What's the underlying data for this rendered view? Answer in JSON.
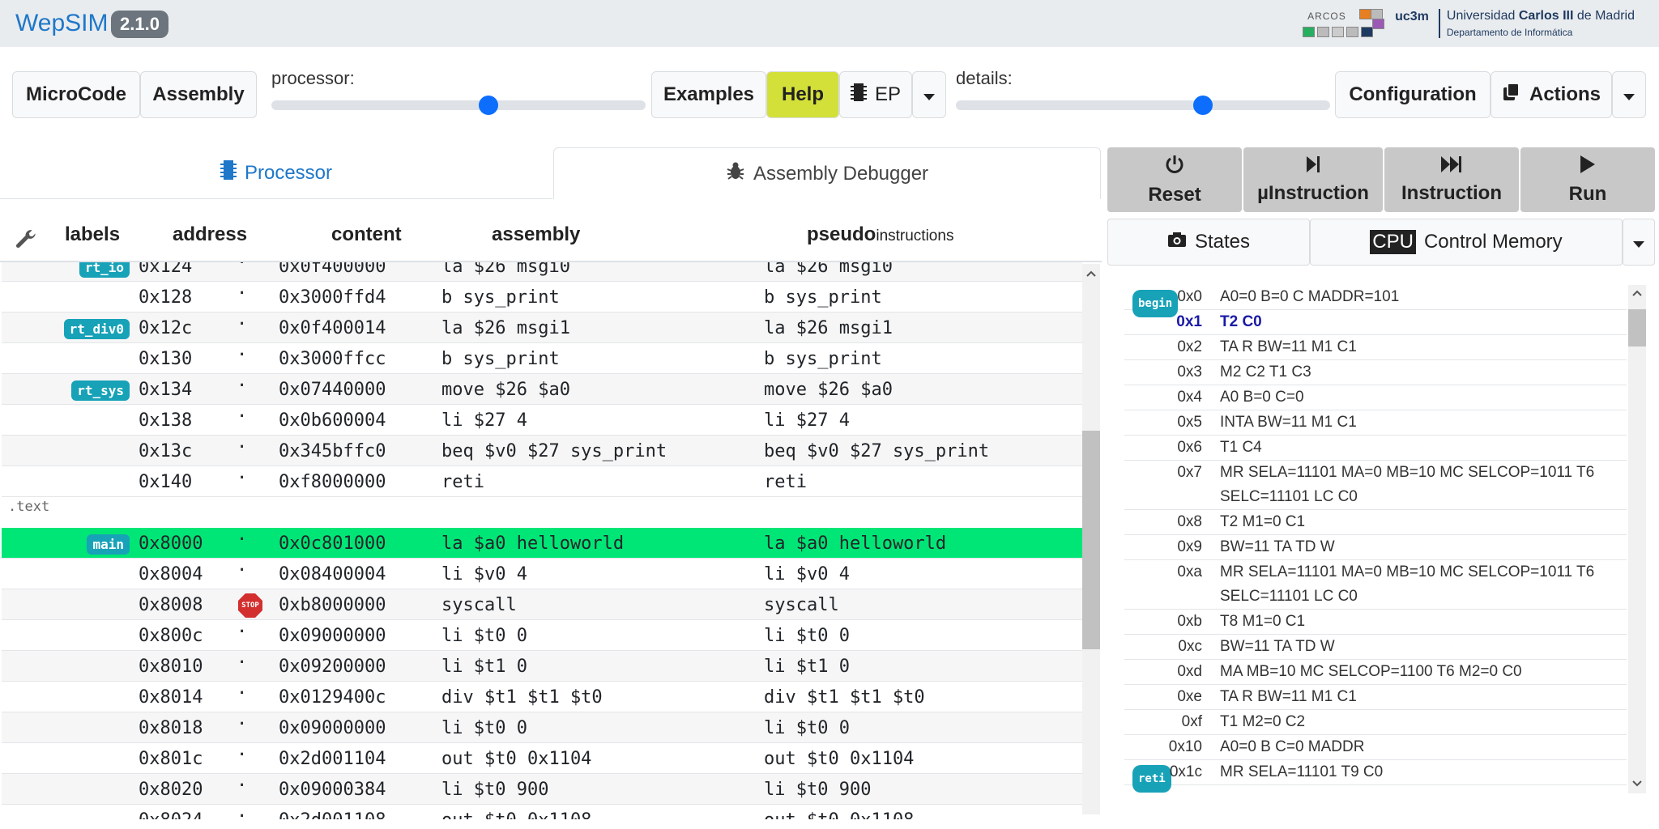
{
  "app": {
    "name": "WepSIM",
    "version": "2.1.0"
  },
  "logos": {
    "arcos": "ARCOS",
    "uc3m": "uc3m",
    "university_prefix": "Universidad ",
    "university_bold": "Carlos III",
    "university_suffix": " de Madrid",
    "department": "Departamento de Informática"
  },
  "toolbar": {
    "microcode": "MicroCode",
    "assembly": "Assembly",
    "processor_label": "processor:",
    "processor_level": 0.58,
    "examples": "Examples",
    "help": "Help",
    "ep": "EP",
    "details_label": "details:",
    "details_level": 0.66,
    "configuration": "Configuration",
    "actions": "Actions"
  },
  "tabs": {
    "processor": "Processor",
    "debugger": "Assembly Debugger"
  },
  "table": {
    "headers": {
      "labels": "labels",
      "address": "address",
      "content": "content",
      "assembly": "assembly",
      "pseudo": "pseudo",
      "pseudo_suffix": "instructions"
    },
    "rows": [
      {
        "label": "rt_io",
        "addr": "0x124",
        "content": "0x0f400000",
        "asm": "la $26 msgi0",
        "pseudo": "la $26 msgi0",
        "partial": true
      },
      {
        "label": "",
        "addr": "0x128",
        "content": "0x3000ffd4",
        "asm": "b sys_print",
        "pseudo": "b sys_print"
      },
      {
        "label": "rt_div0",
        "addr": "0x12c",
        "content": "0x0f400014",
        "asm": "la $26 msgi1",
        "pseudo": "la $26 msgi1"
      },
      {
        "label": "",
        "addr": "0x130",
        "content": "0x3000ffcc",
        "asm": "b sys_print",
        "pseudo": "b sys_print"
      },
      {
        "label": "rt_sys",
        "addr": "0x134",
        "content": "0x07440000",
        "asm": "move $26 $a0",
        "pseudo": "move $26 $a0"
      },
      {
        "label": "",
        "addr": "0x138",
        "content": "0x0b600004",
        "asm": "li $27 4",
        "pseudo": "li $27 4"
      },
      {
        "label": "",
        "addr": "0x13c",
        "content": "0x345bffc0",
        "asm": "beq $v0 $27 sys_print",
        "pseudo": "beq $v0 $27 sys_print"
      },
      {
        "label": "",
        "addr": "0x140",
        "content": "0xf8000000",
        "asm": "reti",
        "pseudo": "reti"
      },
      {
        "section": ".text"
      },
      {
        "label": "main",
        "addr": "0x8000",
        "content": "0x0c801000",
        "asm": "la $a0 helloworld",
        "pseudo": "la $a0 helloworld",
        "current": true
      },
      {
        "label": "",
        "addr": "0x8004",
        "content": "0x08400004",
        "asm": "li $v0 4",
        "pseudo": "li $v0 4"
      },
      {
        "label": "",
        "addr": "0x8008",
        "content": "0xb8000000",
        "asm": "syscall",
        "pseudo": "syscall",
        "breakpoint": "STOP"
      },
      {
        "label": "",
        "addr": "0x800c",
        "content": "0x09000000",
        "asm": "li $t0 0",
        "pseudo": "li $t0 0"
      },
      {
        "label": "",
        "addr": "0x8010",
        "content": "0x09200000",
        "asm": "li $t1 0",
        "pseudo": "li $t1 0"
      },
      {
        "label": "",
        "addr": "0x8014",
        "content": "0x0129400c",
        "asm": "div $t1 $t1 $t0",
        "pseudo": "div $t1 $t1 $t0"
      },
      {
        "label": "",
        "addr": "0x8018",
        "content": "0x09000000",
        "asm": "li $t0 0",
        "pseudo": "li $t0 0"
      },
      {
        "label": "",
        "addr": "0x801c",
        "content": "0x2d001104",
        "asm": "out $t0 0x1104",
        "pseudo": "out $t0 0x1104"
      },
      {
        "label": "",
        "addr": "0x8020",
        "content": "0x09000384",
        "asm": "li $t0 900",
        "pseudo": "li $t0 900"
      },
      {
        "label": "",
        "addr": "0x8024",
        "content": "0x2d001108",
        "asm": "out $t0 0x1108",
        "pseudo": "out $t0 0x1108"
      }
    ]
  },
  "controls": {
    "reset": "Reset",
    "uinstruction": "µInstruction",
    "instruction": "Instruction",
    "run": "Run",
    "states": "States",
    "cpu_badge": "CPU",
    "control_memory": "Control Memory"
  },
  "control_memory": [
    {
      "addr": "0x0",
      "label": "begin",
      "value": "A0=0 B=0 C MADDR=101"
    },
    {
      "addr": "0x1",
      "value": "T2 C0",
      "current": true
    },
    {
      "addr": "0x2",
      "value": "TA R BW=11 M1 C1"
    },
    {
      "addr": "0x3",
      "value": "M2 C2 T1 C3"
    },
    {
      "addr": "0x4",
      "value": "A0 B=0 C=0"
    },
    {
      "addr": "0x5",
      "value": "INTA BW=11 M1 C1"
    },
    {
      "addr": "0x6",
      "value": "T1 C4"
    },
    {
      "addr": "0x7",
      "value": "MR SELA=11101 MA=0 MB=10 MC SELCOP=1011 T6 SELC=11101 LC C0"
    },
    {
      "addr": "0x8",
      "value": "T2 M1=0 C1"
    },
    {
      "addr": "0x9",
      "value": "BW=11 TA TD W"
    },
    {
      "addr": "0xa",
      "value": "MR SELA=11101 MA=0 MB=10 MC SELCOP=1011 T6 SELC=11101 LC C0"
    },
    {
      "addr": "0xb",
      "value": "T8 M1=0 C1"
    },
    {
      "addr": "0xc",
      "value": "BW=11 TA TD W"
    },
    {
      "addr": "0xd",
      "value": "MA MB=10 MC SELCOP=1100 T6 M2=0 C0"
    },
    {
      "addr": "0xe",
      "value": "TA R BW=11 M1 C1"
    },
    {
      "addr": "0xf",
      "value": "T1 M2=0 C2"
    },
    {
      "addr": "0x10",
      "value": "A0=0 B C=0 MADDR"
    },
    {
      "addr": "0x1c",
      "label": "reti",
      "value": "MR SELA=11101 T9 C0"
    }
  ]
}
